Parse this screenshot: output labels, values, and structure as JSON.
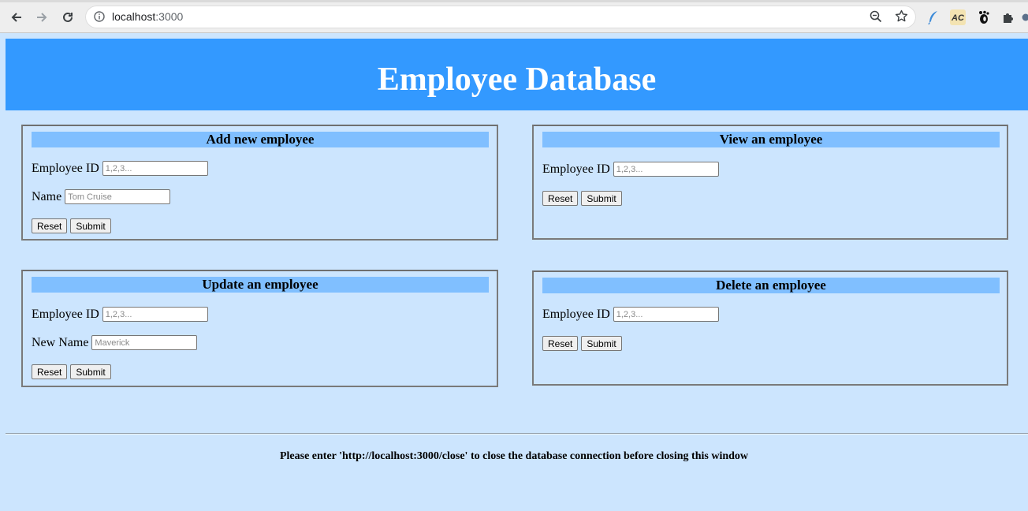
{
  "browser": {
    "url_host": "localhost",
    "url_port": ":3000"
  },
  "page": {
    "title": "Employee Database",
    "footer": "Please enter 'http://localhost:3000/close' to close the database connection before closing this window"
  },
  "panels": {
    "add": {
      "title": "Add new employee",
      "id_label": "Employee ID",
      "id_placeholder": "1,2,3...",
      "name_label": "Name",
      "name_placeholder": "Tom Cruise",
      "reset": "Reset",
      "submit": "Submit"
    },
    "view": {
      "title": "View an employee",
      "id_label": "Employee ID",
      "id_placeholder": "1,2,3...",
      "reset": "Reset",
      "submit": "Submit"
    },
    "update": {
      "title": "Update an employee",
      "id_label": "Employee ID",
      "id_placeholder": "1,2,3...",
      "name_label": "New Name",
      "name_placeholder": "Maverick",
      "reset": "Reset",
      "submit": "Submit"
    },
    "delete": {
      "title": "Delete an employee",
      "id_label": "Employee ID",
      "id_placeholder": "1,2,3...",
      "reset": "Reset",
      "submit": "Submit"
    }
  },
  "colors": {
    "page_bg": "#cce5fe",
    "header_bg": "#3399ff",
    "panel_title_bg": "#80bfff"
  }
}
